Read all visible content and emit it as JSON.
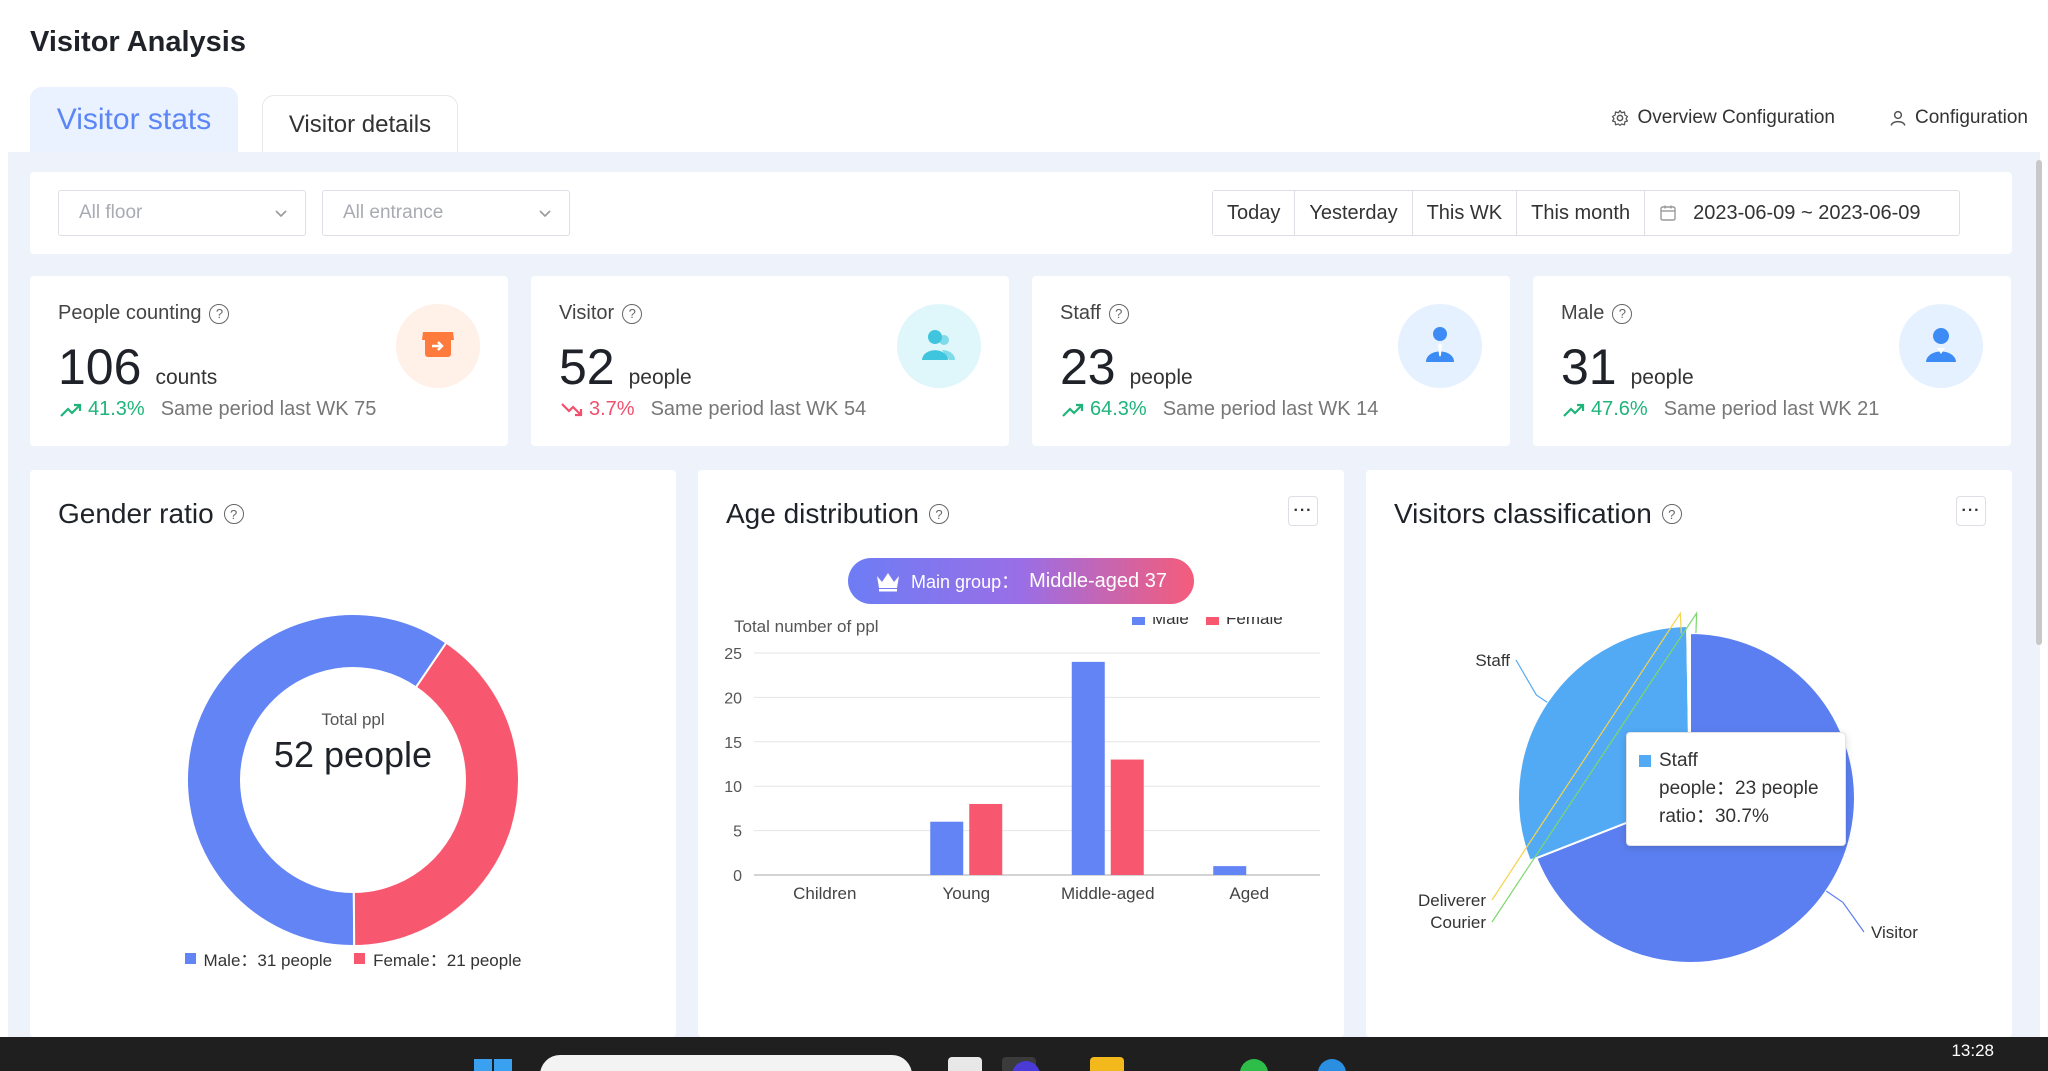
{
  "header": {
    "title": "Visitor Analysis",
    "tabs": [
      {
        "label": "Visitor stats"
      },
      {
        "label": "Visitor details"
      }
    ],
    "overview_config": "Overview Configuration",
    "config": "Configuration"
  },
  "filters": {
    "floor": "All floor",
    "entrance": "All entrance",
    "date_buttons": [
      "Today",
      "Yesterday",
      "This WK",
      "This month"
    ],
    "date_range": "2023-06-09 ~ 2023-06-09"
  },
  "stats": [
    {
      "label": "People counting",
      "value": "106",
      "unit": "counts",
      "pct": "41.3%",
      "direction": "up",
      "compare": "Same period last WK 75",
      "icon": "store-icon",
      "icon_bg": "#fff0e8",
      "icon_color": "#ff7a3d"
    },
    {
      "label": "Visitor",
      "value": "52",
      "unit": "people",
      "pct": "3.7%",
      "direction": "down",
      "compare": "Same period last WK 54",
      "icon": "visitor-icon",
      "icon_bg": "#dff7fb",
      "icon_color": "#3fc6de"
    },
    {
      "label": "Staff",
      "value": "23",
      "unit": "people",
      "pct": "64.3%",
      "direction": "up",
      "compare": "Same period last WK 14",
      "icon": "staff-icon",
      "icon_bg": "#e6f1ff",
      "icon_color": "#3d8bf5"
    },
    {
      "label": "Male",
      "value": "31",
      "unit": "people",
      "pct": "47.6%",
      "direction": "up",
      "compare": "Same period last WK 21",
      "icon": "male-icon",
      "icon_bg": "#e6f1ff",
      "icon_color": "#3d8bf5"
    }
  ],
  "gender": {
    "title": "Gender ratio",
    "center_label": "Total ppl",
    "center_value": "52 people",
    "legend_male": "Male：31 people",
    "legend_female": "Female：21 people"
  },
  "age": {
    "title": "Age distribution",
    "main_group_label": "Main group：",
    "main_group_value": "Middle-aged 37"
  },
  "classification": {
    "title": "Visitors classification",
    "labels": {
      "staff": "Staff",
      "deliverer": "Deliverer",
      "courier": "Courier",
      "visitor": "Visitor"
    },
    "tooltip": {
      "name": "Staff",
      "people": "people：23 people",
      "ratio": "ratio：30.7%"
    }
  },
  "taskbar": {
    "clock": "13:28"
  },
  "colors": {
    "male": "#6284f5",
    "female": "#f8586f",
    "staff": "#52aaf5",
    "visitor": "#5b7ff0",
    "deliverer": "#f5d34a",
    "courier": "#7bd86b",
    "accent": "#5b86f6"
  },
  "chart_data": [
    {
      "type": "pie",
      "title": "Gender ratio",
      "categories": [
        "Male",
        "Female"
      ],
      "values": [
        31,
        21
      ]
    },
    {
      "type": "bar",
      "title": "Age distribution",
      "ylabel": "Total number of ppl",
      "categories": [
        "Children",
        "Young",
        "Middle-aged",
        "Aged"
      ],
      "series": [
        {
          "name": "Male",
          "values": [
            0,
            6,
            24,
            1
          ]
        },
        {
          "name": "Female",
          "values": [
            0,
            8,
            13,
            0
          ]
        }
      ],
      "ylim": [
        0,
        25
      ],
      "yticks": [
        0,
        5,
        10,
        15,
        20,
        25
      ],
      "legend": "top-right"
    },
    {
      "type": "pie",
      "title": "Visitors classification",
      "categories": [
        "Visitor",
        "Staff",
        "Deliverer",
        "Courier"
      ],
      "values": [
        51.8,
        23,
        0.1,
        0.1
      ]
    }
  ]
}
